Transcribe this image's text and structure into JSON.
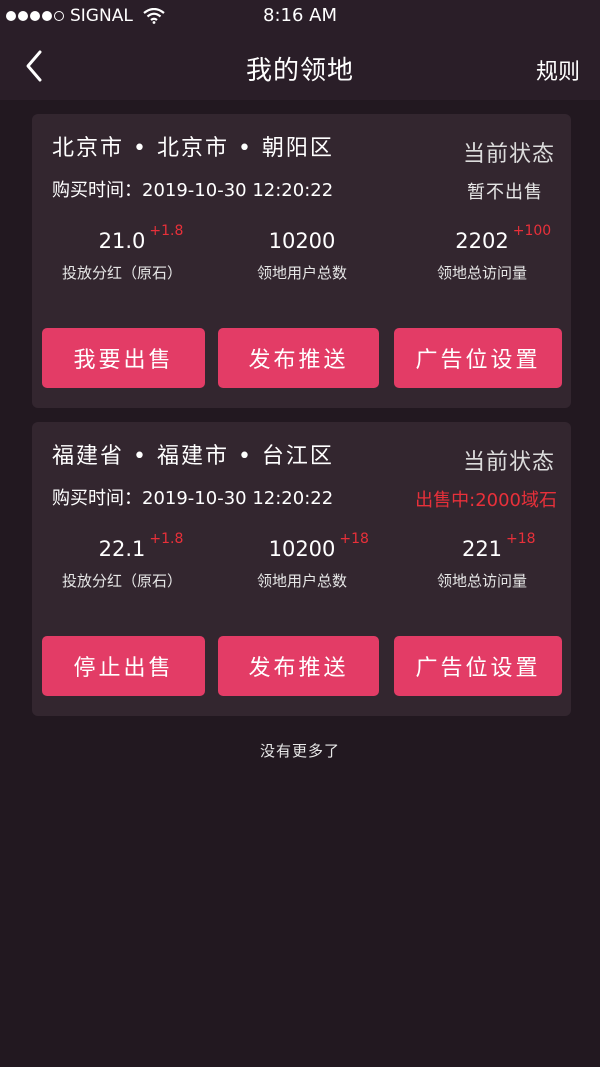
{
  "status_bar": {
    "carrier": "SIGNAL",
    "time": "8:16 AM"
  },
  "nav": {
    "title": "我的领地",
    "rules": "规则"
  },
  "cards": [
    {
      "address": "北京市 • 北京市 • 朝阳区",
      "status_label": "当前状态",
      "status_value": "暂不出售",
      "buy_time": "购买时间：2019-10-30 12:20:22",
      "stats": [
        {
          "value": "21.0",
          "delta": "+1.8",
          "label": "投放分红（原石）"
        },
        {
          "value": "10200",
          "delta": "",
          "label": "领地用户总数"
        },
        {
          "value": "2202",
          "delta": "+100",
          "label": "领地总访问量"
        }
      ],
      "buttons": [
        "我要出售",
        "发布推送",
        "广告位设置"
      ]
    },
    {
      "address": "福建省 • 福建市 • 台江区",
      "status_label": "当前状态",
      "status_value": "出售中:2000域石",
      "buy_time": "购买时间：2019-10-30 12:20:22",
      "stats": [
        {
          "value": "22.1",
          "delta": "+1.8",
          "label": "投放分红（原石）"
        },
        {
          "value": "10200",
          "delta": "+18",
          "label": "领地用户总数"
        },
        {
          "value": "221",
          "delta": "+18",
          "label": "领地总访问量"
        }
      ],
      "buttons": [
        "停止出售",
        "发布推送",
        "广告位设置"
      ]
    }
  ],
  "footer": {
    "no_more": "没有更多了"
  },
  "colors": {
    "accent": "#e33c66",
    "delta": "#e8303a",
    "background": "#221820",
    "card": "#33262f"
  }
}
